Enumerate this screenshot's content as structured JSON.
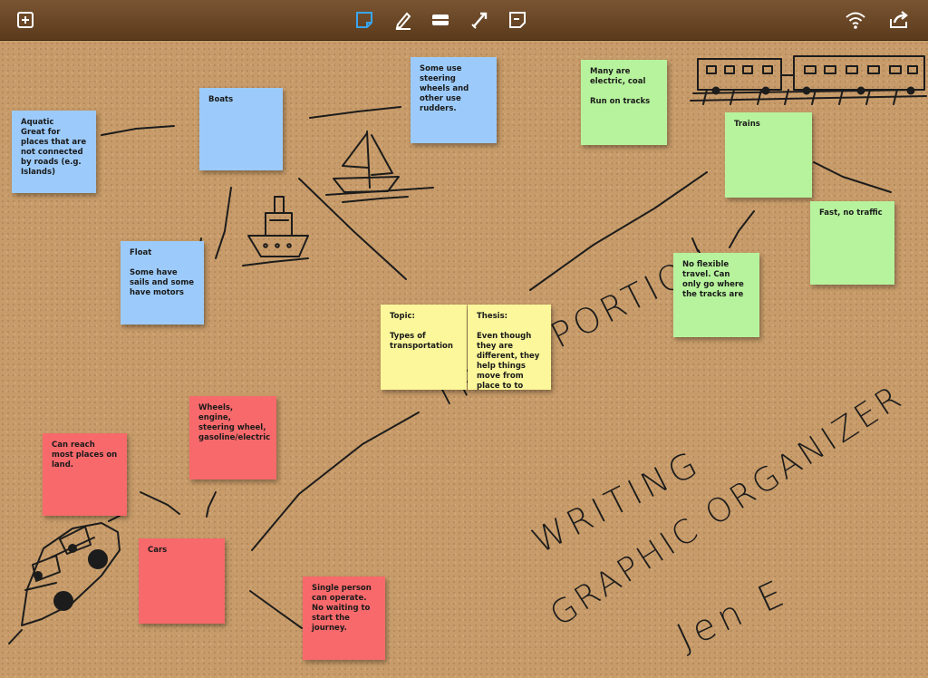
{
  "toolbar": {
    "left": [
      "add-note-icon"
    ],
    "center": [
      "sticky-note-tool-icon",
      "pen-tool-icon",
      "eraser-tool-icon",
      "connector-tool-icon",
      "note-style-icon"
    ],
    "right": [
      "wifi-icon",
      "share-icon"
    ],
    "active_tool": "sticky-note-tool-icon",
    "active_color": "#37a6f5"
  },
  "notes": {
    "aquatic": "Aquatic\nGreat for places that are not connected by roads (e.g. Islands)",
    "boats": "Boats",
    "steering": "Some use steering wheels and other use rudders.",
    "float": "Float\n\nSome have sails and some have motors",
    "many": "Many are electric, coal\n\nRun on tracks",
    "trains": "Trains",
    "fast": "Fast, no traffic",
    "noflex": "No flexible travel. Can only go where the tracks are",
    "topic": "Topic:\n\nTypes of transportation",
    "thesis": "Thesis:\n\nEven though they are different, they help things move from place to to place",
    "wheels": "Wheels, engine, steering wheel, gasoline/electric",
    "land": "Can reach most places on land.",
    "cars": "Cars",
    "single": "Single person can operate.  No waiting to start the journey."
  },
  "handwriting": {
    "line1": "TRANSPORTION",
    "line2": "WRITING",
    "line3": "GRAPHIC ORGANIZER",
    "line4": "Jen E"
  },
  "colors": {
    "board": "#c89c6a",
    "toolbar": "#6b4726",
    "blue_note": "#9ccbfb",
    "green_note": "#b7f39d",
    "yellow_note": "#fbf79a",
    "red_note": "#f8696b",
    "ink": "#1c1c1c"
  }
}
